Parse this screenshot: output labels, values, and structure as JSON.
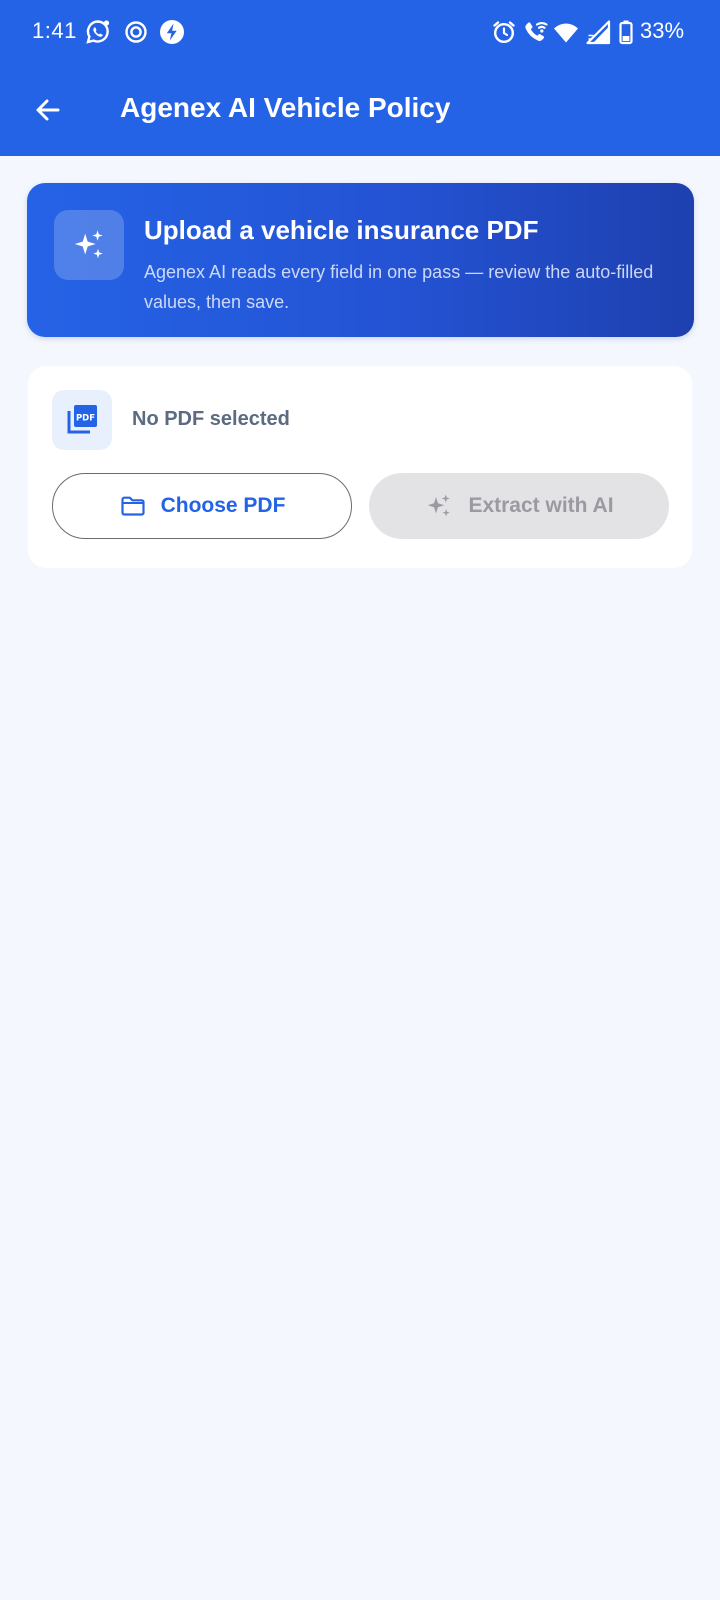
{
  "status_bar": {
    "time": "1:41",
    "battery_percent": "33%",
    "left_icons": [
      "whatsapp-icon",
      "focus-icon",
      "bolt-icon"
    ],
    "right_icons": [
      "alarm-icon",
      "wifi-call-icon",
      "wifi-icon",
      "signal-icon",
      "battery-icon"
    ]
  },
  "app_bar": {
    "title": "Agenex AI Vehicle Policy",
    "background_color": "#2563e6",
    "back_icon": "arrow-left-icon"
  },
  "hero": {
    "icon": "sparkles-icon",
    "title": "Upload a vehicle insurance PDF",
    "subtitle": "Agenex AI reads every field in one pass — review the auto-filled values, then save."
  },
  "file_picker": {
    "icon": "pdf-file-icon",
    "status_text": "No PDF selected",
    "choose_button": {
      "label": "Choose PDF",
      "icon": "folder-icon"
    },
    "extract_button": {
      "label": "Extract with AI",
      "icon": "sparkles-icon",
      "enabled": false
    }
  },
  "colors": {
    "primary": "#2563e6",
    "page_background": "#f4f7fd",
    "disabled_button": "#e3e3e5"
  }
}
